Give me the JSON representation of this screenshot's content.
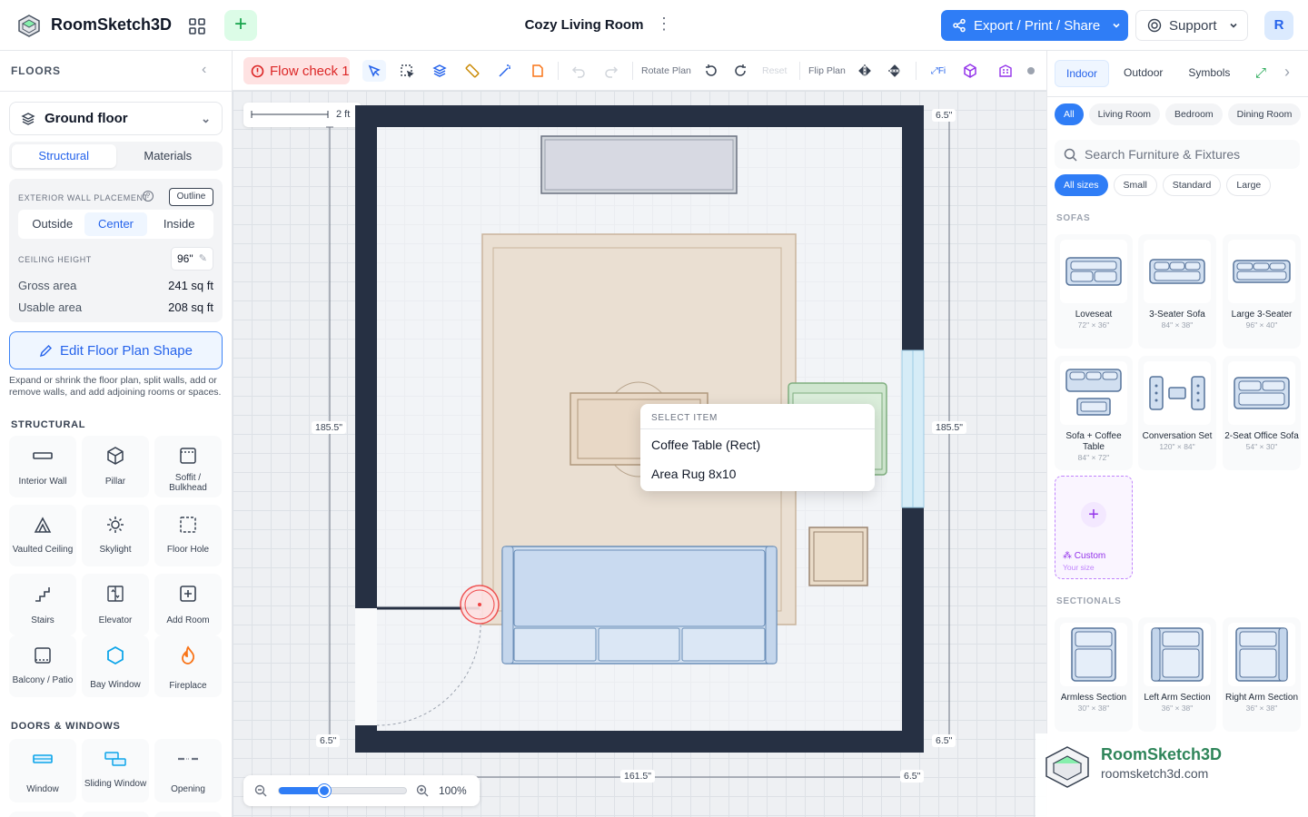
{
  "app": {
    "name": "RoomSketch3D",
    "avatar_initial": "R",
    "accent": "#2f7df6"
  },
  "project": {
    "title": "Cozy Living Room"
  },
  "header": {
    "export_label": "Export / Print / Share",
    "support_label": "Support"
  },
  "left_panel": {
    "title": "FLOORS",
    "floor_selected": "Ground floor",
    "tabs": [
      "Structural",
      "Materials"
    ],
    "active_tab": "Structural",
    "exterior_wall_label": "EXTERIOR WALL PLACEMENT",
    "outline_label": "Outline",
    "placement_options": [
      "Outside",
      "Center",
      "Inside"
    ],
    "placement_selected": "Center",
    "ceiling_height_label": "CEILING HEIGHT",
    "ceiling_height_value": "96\"",
    "gross_area_label": "Gross area",
    "gross_area_value": "241 sq ft",
    "usable_area_label": "Usable area",
    "usable_area_value": "208 sq ft",
    "edit_shape_label": "Edit Floor Plan Shape",
    "edit_shape_hint": "Expand or shrink the floor plan, split walls, add or remove walls, and add adjoining rooms or spaces.",
    "structural_heading": "STRUCTURAL",
    "structural_items": [
      {
        "label": "Interior Wall",
        "icon": "wall-icon"
      },
      {
        "label": "Pillar",
        "icon": "cube-icon"
      },
      {
        "label": "Soffit / Bulkhead",
        "icon": "soffit-icon"
      },
      {
        "label": "Vaulted Ceiling",
        "icon": "vault-icon"
      },
      {
        "label": "Skylight",
        "icon": "sun-icon"
      },
      {
        "label": "Floor Hole",
        "icon": "dashed-square-icon"
      },
      {
        "label": "Stairs",
        "icon": "stairs-icon"
      },
      {
        "label": "Elevator",
        "icon": "elevator-icon"
      },
      {
        "label": "Add Room",
        "icon": "plus-square-icon"
      },
      {
        "label": "Balcony / Patio",
        "icon": "balcony-icon"
      },
      {
        "label": "Bay Window",
        "icon": "hexagon-icon"
      },
      {
        "label": "Fireplace",
        "icon": "flame-icon"
      }
    ],
    "doors_heading": "DOORS & WINDOWS",
    "door_items": [
      {
        "label": "Window",
        "icon": "window-icon"
      },
      {
        "label": "Sliding Window",
        "icon": "sliding-window-icon"
      },
      {
        "label": "Opening",
        "icon": "opening-icon"
      }
    ]
  },
  "toolbar": {
    "flow_check_label": "Flow check 1",
    "rotate_label": "Rotate Plan",
    "reset_label": "Reset",
    "flip_label": "Flip Plan",
    "fit_label": "Fi"
  },
  "canvas": {
    "scale_label": "2 ft",
    "dim_left": "185.5\"",
    "dim_right": "185.5\"",
    "dim_top_right": "6.5\"",
    "dim_bottom_left": "6.5\"",
    "dim_bottom_right": "6.5\"",
    "dim_bottom_width": "161.5\"",
    "dim_bottom_right2": "6.5\"",
    "zoom_value": 0.35,
    "zoom_label": "100%",
    "popup": {
      "heading": "SELECT ITEM",
      "items": [
        "Coffee Table (Rect)",
        "Area Rug 8x10"
      ]
    }
  },
  "right_panel": {
    "tabs": [
      "Indoor",
      "Outdoor",
      "Symbols"
    ],
    "active_tab": "Indoor",
    "room_chips": [
      "All",
      "Living Room",
      "Bedroom",
      "Dining Room"
    ],
    "search_placeholder": "Search Furniture & Fixtures",
    "size_chips": [
      "All sizes",
      "Small",
      "Standard",
      "Large"
    ],
    "sofas_heading": "SOFAS",
    "sofas": [
      {
        "name": "Loveseat",
        "dims": "72\" × 36\""
      },
      {
        "name": "3-Seater Sofa",
        "dims": "84\" × 38\""
      },
      {
        "name": "Large 3-Seater",
        "dims": "96\" × 40\""
      },
      {
        "name": "Sofa + Coffee Table",
        "dims": "84\" × 72\""
      },
      {
        "name": "Conversation Set",
        "dims": "120\" × 84\""
      },
      {
        "name": "2-Seat Office Sofa",
        "dims": "54\" × 30\""
      }
    ],
    "custom_label": "Custom",
    "custom_sub": "Your size",
    "sectionals_heading": "SECTIONALS",
    "sectionals": [
      {
        "name": "Armless Section",
        "dims": "30\" × 38\""
      },
      {
        "name": "Left Arm Section",
        "dims": "36\" × 38\""
      },
      {
        "name": "Right Arm Section",
        "dims": "36\" × 38\""
      }
    ]
  },
  "watermark": {
    "name": "RoomSketch3D",
    "url": "roomsketch3d.com"
  }
}
